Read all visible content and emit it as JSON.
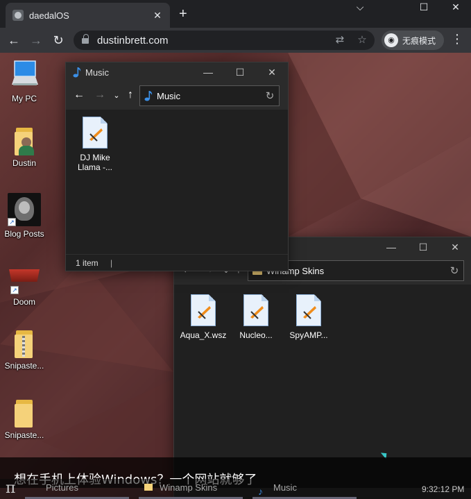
{
  "browser": {
    "tab_title": "daedalOS",
    "tab_close": "✕",
    "new_tab": "+",
    "url": "dustinbrett.com",
    "incognito_label": "无痕模式",
    "minimize": "⌵",
    "restore": "☐",
    "close": "✕"
  },
  "desktop_icons": [
    {
      "label": "My PC",
      "icon": "computer-icon"
    },
    {
      "label": "Dustin",
      "icon": "user-folder-icon"
    },
    {
      "label": "Blog Posts",
      "icon": "blog-posts-shortcut-icon"
    },
    {
      "label": "Doom",
      "icon": "doom-shortcut-icon"
    },
    {
      "label": "Snipaste...",
      "icon": "zip-folder-icon"
    },
    {
      "label": "Snipaste...",
      "icon": "folder-icon"
    }
  ],
  "music_window": {
    "title": "Music",
    "address": "Music",
    "files": [
      {
        "label": "DJ Mike Llama -..."
      }
    ],
    "status": "1 item"
  },
  "skins_window": {
    "address": "Winamp Skins",
    "files": [
      {
        "label": "Aqua_X.wsz"
      },
      {
        "label": "Nucleo..."
      },
      {
        "label": "SpyAMP..."
      }
    ]
  },
  "subtitle": "想在手机上体验Windows？一个网站就够了",
  "taskbar": {
    "start": "π",
    "items": [
      {
        "label": "Pictures"
      },
      {
        "label": "Winamp Skins"
      },
      {
        "label": "Music"
      }
    ],
    "clock": "9:32:12 PM"
  },
  "colors": {
    "accent": "#1e90ff",
    "folder": "#f5d27a",
    "window_bg": "#202020"
  }
}
